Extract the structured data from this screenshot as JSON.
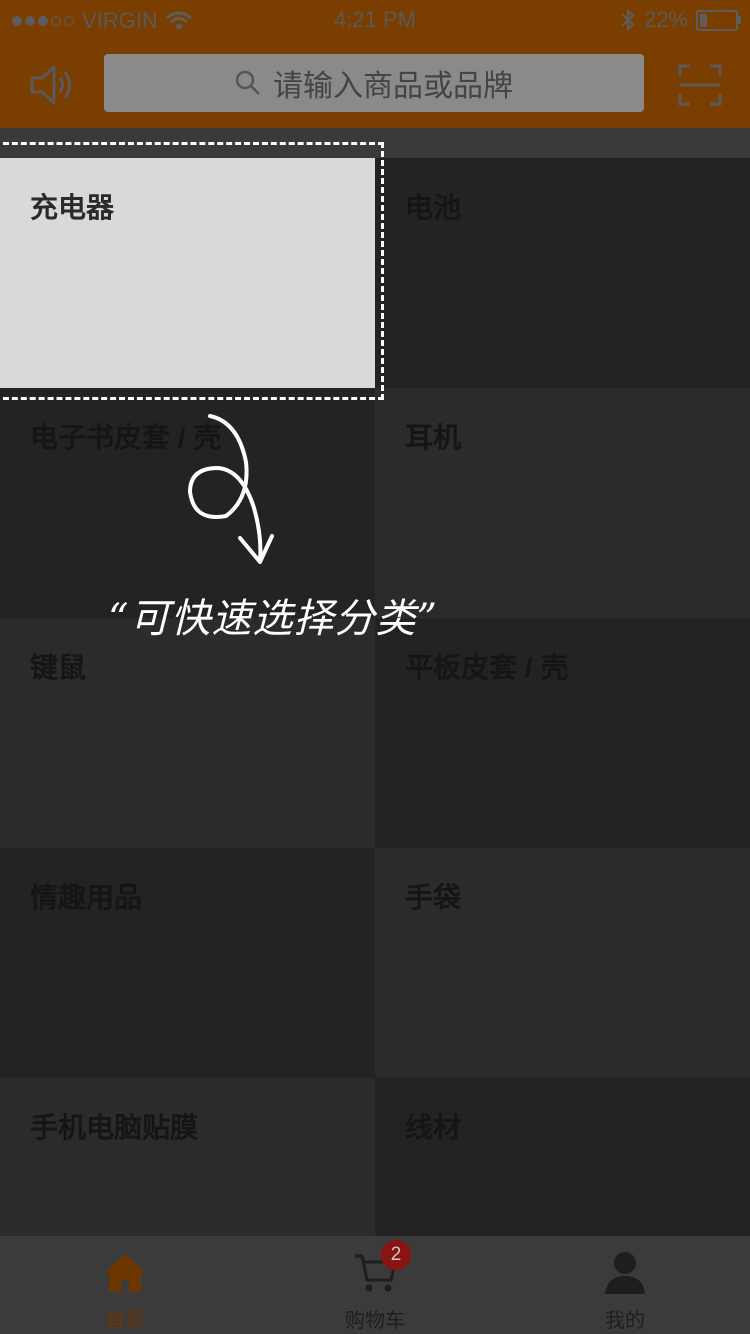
{
  "status_bar": {
    "carrier": "VIRGIN",
    "time": "4:21 PM",
    "battery": "22%",
    "battery_level": 0.22
  },
  "header": {
    "search_placeholder": "请输入商品或品牌",
    "left_icon": "speaker-icon",
    "right_icon": "scan-icon",
    "accent_color": "#ff8a00"
  },
  "categories": [
    {
      "label": "充电器",
      "selected": true
    },
    {
      "label": "电池"
    },
    {
      "label": "电子书皮套 / 壳"
    },
    {
      "label": "耳机"
    },
    {
      "label": "键鼠"
    },
    {
      "label": "平板皮套 / 壳"
    },
    {
      "label": "情趣用品"
    },
    {
      "label": "手袋"
    },
    {
      "label": "手机电脑贴膜"
    },
    {
      "label": "线材"
    }
  ],
  "annotation": {
    "text": "“可快速选择分类”"
  },
  "tabbar": {
    "tabs": [
      {
        "label": "首页",
        "icon": "home-icon",
        "active": true
      },
      {
        "label": "购物车",
        "icon": "cart-icon",
        "badge": "2"
      },
      {
        "label": "我的",
        "icon": "user-icon"
      }
    ]
  }
}
